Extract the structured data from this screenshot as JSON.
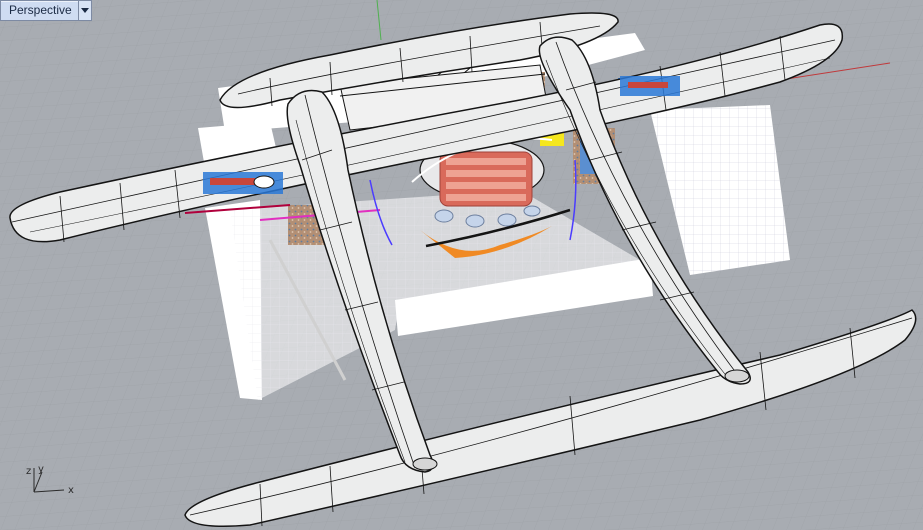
{
  "viewport": {
    "title": "Perspective",
    "dropdown_icon": "chevron-down-icon",
    "background_color": "#a8acb2",
    "grid_color": "#9da1a7",
    "grid_major_color": "#8e9298"
  },
  "axes": {
    "x_label": "x",
    "y_label": "y",
    "z_label": "z",
    "world_x_color": "#c0393b",
    "world_y_color": "#4fb04f"
  },
  "model": {
    "hull_fill": "#eceded",
    "deck_fill": "#ffffff",
    "outline_color": "#141414",
    "accent_colors": [
      "#f5e71e",
      "#f08a24",
      "#c8463c",
      "#2a78d6",
      "#e12fc0",
      "#8a6a4a"
    ]
  }
}
